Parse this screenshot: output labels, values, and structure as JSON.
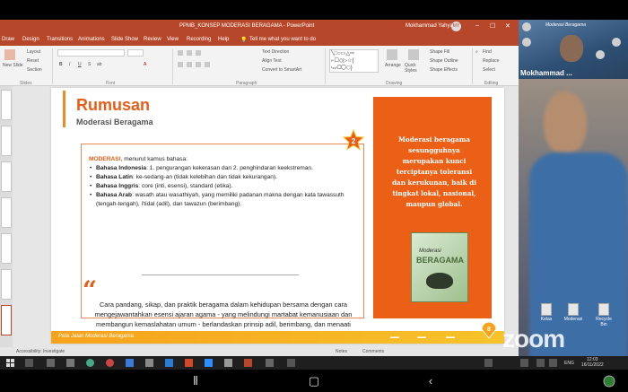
{
  "window": {
    "title": "PPMB_KONSEP MODERASI BERAGAMA - PowerPoint",
    "user": "Mokhammad Yahya",
    "avatar_initials": "MY"
  },
  "menu": {
    "tabs": [
      "Draw",
      "Design",
      "Transitions",
      "Animations",
      "Slide Show",
      "Review",
      "View",
      "Recording",
      "Help"
    ],
    "active_index": -1,
    "tell_me": "Tell me what you want to do"
  },
  "ribbon": {
    "slides": {
      "new": "New Slide",
      "layout": "Layout",
      "reset": "Reset",
      "section": "Section",
      "group": "Slides"
    },
    "font_group": "Font",
    "paragraph": {
      "text_direction": "Text Direction",
      "align_text": "Align Text",
      "convert": "Convert to SmartArt",
      "group": "Paragraph"
    },
    "drawing": {
      "arrange": "Arrange",
      "quick_styles": "Quick Styles",
      "fill": "Shape Fill",
      "outline": "Shape Outline",
      "effects": "Shape Effects",
      "group": "Drawing"
    },
    "editing": {
      "find": "Find",
      "replace": "Replace",
      "select": "Select",
      "group": "Editing"
    }
  },
  "slide": {
    "title": "Rumusan",
    "subtitle": "Moderasi Beragama",
    "defs_intro_bold": "MODERASI",
    "defs_intro_rest": ", menurut kamus bahasa:",
    "defs": [
      {
        "label": "Bahasa Indonesia",
        "text": ": 1. pengurangan kekerasan dan 2. penghindaran keekstreman."
      },
      {
        "label": "Bahasa Latin",
        "text": ": ke-sedang-an (tidak kelebihan dan tidak kekurangan)."
      },
      {
        "label": "Bahasa Inggris",
        "text": ": core (inti, esensi), standard (etika)."
      },
      {
        "label": "Bahasa Arab",
        "text": ": wasath atau wasathiyah, yang memiliki padanan makna dengan kata tawassuth (tengah-tengah), i'tidal (adil), dan tawazun (berimbang)."
      }
    ],
    "quote_open": "“",
    "quote_close": "”",
    "quote": "Cara pandang, sikap, dan praktik beragama dalam kehidupan bersama dengan cara mengejawantahkan esensi ajaran agama - yang melindungi martabat kemanusiaan dan membangun kemaslahatan umum - berlandaskan prinsip adil, berimbang, dan menaati konstitusi sebagai kesepakatan berbangsa",
    "star_number": "2",
    "panel_text": "Moderasi beragama sesungguhnya merupakan kunci terciptanya toleransi dan kerukunan, baik di tingkat lokal, nasional, maupun global.",
    "book_subtitle": "Moderasi",
    "book_title": "BERAGAMA",
    "footer": "Peta Jalan Moderasi Beragama",
    "page_number": "8"
  },
  "status": {
    "accessibility": "Accessibility: Investigate",
    "notes": "Notes",
    "comments": "Comments"
  },
  "zoom": {
    "speaker_name": "Mokhammad ...",
    "banner": "Moderasi Beragama",
    "logo": "zoom",
    "desktop_icons": [
      "Kelas",
      "Moderasi",
      "Recycle Bin"
    ]
  },
  "taskbar": {
    "lang": "ENG",
    "time": "12:03",
    "date": "16/11/2022"
  },
  "colors": {
    "ppt_red": "#b7472a",
    "slide_orange": "#ec5f17",
    "footer_yellow": "#f7a21b"
  }
}
